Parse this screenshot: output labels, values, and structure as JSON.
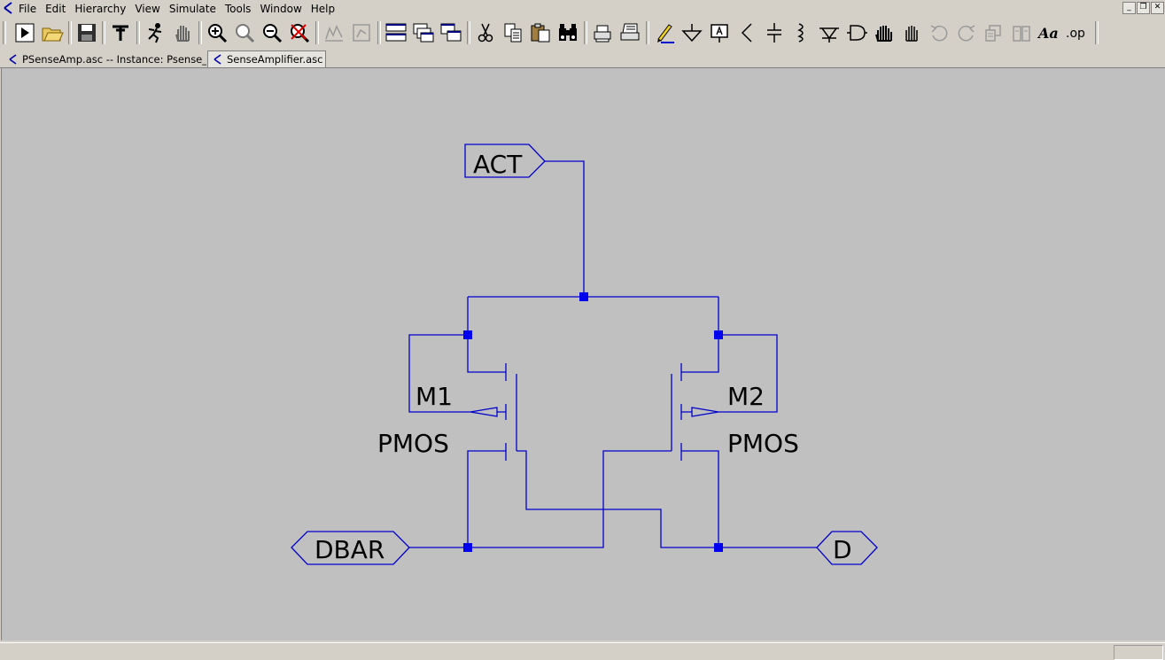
{
  "menu": {
    "items": [
      "File",
      "Edit",
      "Hierarchy",
      "View",
      "Simulate",
      "Tools",
      "Window",
      "Help"
    ]
  },
  "window_controls": [
    "minimize",
    "restore",
    "close"
  ],
  "toolbar": {
    "buttons": [
      "run-icon",
      "open-icon",
      "save-icon",
      "control-panel-icon",
      "halt-icon",
      "pan-icon",
      "zoom-in-icon",
      "zoom-full-icon",
      "zoom-out-icon",
      "zoom-cancel-icon",
      "autoscale-icon",
      "fit-icon",
      "tile-horizontal-icon",
      "cascade-icon",
      "tile-vertical-icon",
      "cut-icon",
      "copy-icon",
      "paste-icon",
      "find-icon",
      "print-icon",
      "print-setup-icon",
      "draw-wire-icon",
      "ground-icon",
      "label-net-icon",
      "resistor-icon",
      "capacitor-icon",
      "inductor-icon",
      "diode-icon",
      "component-icon",
      "move-icon",
      "drag-icon",
      "undo-icon",
      "redo-icon",
      "rotate-icon",
      "mirror-icon",
      "text-icon",
      "spice-directive-icon"
    ]
  },
  "tabs": [
    {
      "label": "PSenseAmp.asc -- Instance: Psense_A",
      "active": false
    },
    {
      "label": "SenseAmplifier.asc",
      "active": true
    }
  ],
  "schematic": {
    "labels": {
      "act": "ACT",
      "dbar": "DBAR",
      "d": "D",
      "m1_name": "M1",
      "m1_type": "PMOS",
      "m2_name": "M2",
      "m2_type": "PMOS"
    },
    "wire_color": "#0000cc",
    "junction_color": "#0000ee"
  },
  "colors": {
    "background": "#d4d0c8",
    "canvas": "#c0c0c0"
  }
}
